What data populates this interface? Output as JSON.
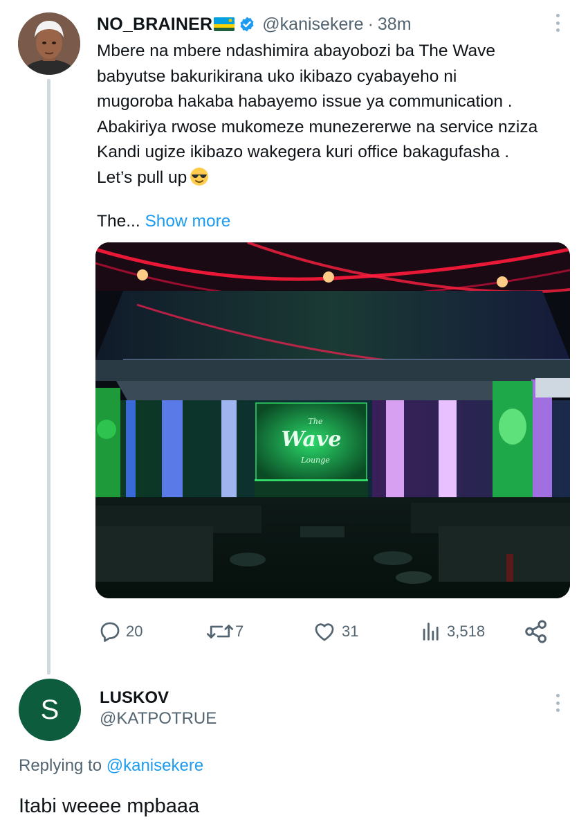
{
  "tweet": {
    "author_name": "NO_BRAINER",
    "handle": "@kanisekere",
    "separator": "·",
    "time": "38m",
    "text_lines": [
      "Mbere na mbere ndashimira abayobozi ba The Wave",
      "babyutse bakurikirana uko ikibazo cyabayeho ni",
      "mugoroba hakaba habayemo issue  ya communication .",
      "Abakiriya rwose mukomeze munezererwe na service nziza",
      "Kandi ugize ikibazo wakegera kuri office bakagufasha .",
      "Let’s pull up"
    ],
    "truncated_text": "The...",
    "show_more_label": "Show more",
    "media": {
      "sign_line1": "The",
      "sign_line2": "Wave",
      "sign_line3": "Lounge"
    },
    "stats": {
      "replies": "20",
      "retweets": "7",
      "likes": "31",
      "views": "3,518"
    }
  },
  "icons": {
    "flag": "rwanda-flag-icon",
    "verified": "verified-badge-icon",
    "emoji": "smiling-face-with-sunglasses-icon",
    "reply": "reply-icon",
    "retweet": "retweet-icon",
    "like": "heart-icon",
    "views": "views-bar-chart-icon",
    "share": "share-icon",
    "more": "more-vertical-icon"
  },
  "reply": {
    "avatar_letter": "S",
    "author_name": "LUSKOV",
    "handle": "@KATPOTRUE",
    "replying_prefix": "Replying to",
    "replying_mention": "@kanisekere",
    "text": "Itabi weeee mpbaaa"
  },
  "colors": {
    "link": "#1d9bf0",
    "secondary_text": "#536471",
    "reply_avatar": "#0d5c3e",
    "thread_line": "#cfd9de"
  }
}
